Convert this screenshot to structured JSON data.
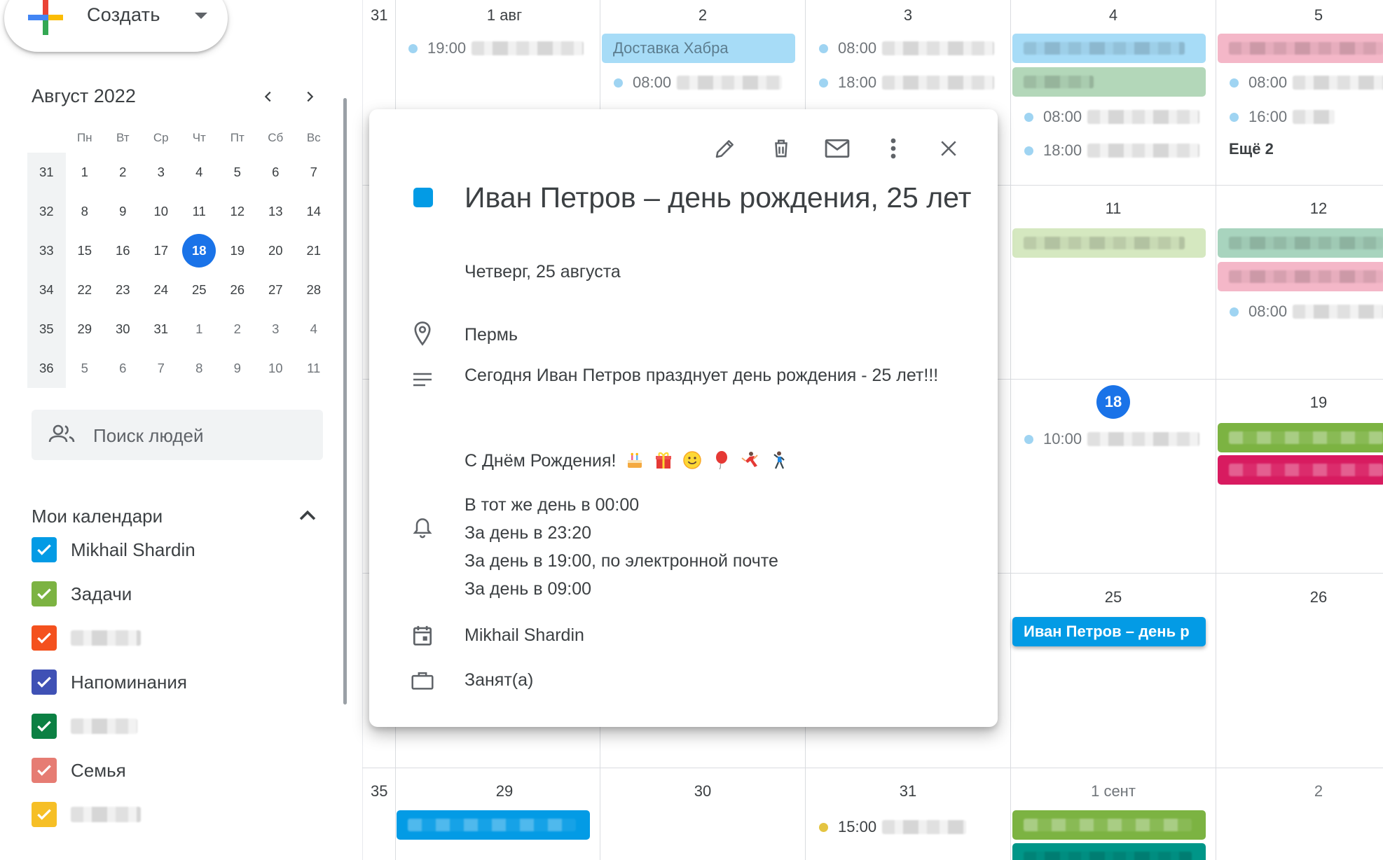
{
  "create": {
    "label": "Создать"
  },
  "mini": {
    "title": "Август 2022",
    "weekdays": [
      "Пн",
      "Вт",
      "Ср",
      "Чт",
      "Пт",
      "Сб",
      "Вс"
    ],
    "rows": [
      {
        "wk": "31",
        "days": [
          "1",
          "2",
          "3",
          "4",
          "5",
          "6",
          "7"
        ]
      },
      {
        "wk": "32",
        "days": [
          "8",
          "9",
          "10",
          "11",
          "12",
          "13",
          "14"
        ]
      },
      {
        "wk": "33",
        "days": [
          "15",
          "16",
          "17",
          "18",
          "19",
          "20",
          "21"
        ]
      },
      {
        "wk": "34",
        "days": [
          "22",
          "23",
          "24",
          "25",
          "26",
          "27",
          "28"
        ]
      },
      {
        "wk": "35",
        "days": [
          "29",
          "30",
          "31",
          "1",
          "2",
          "3",
          "4"
        ]
      },
      {
        "wk": "36",
        "days": [
          "5",
          "6",
          "7",
          "8",
          "9",
          "10",
          "11"
        ]
      }
    ],
    "today": "18"
  },
  "people_search": {
    "placeholder": "Поиск людей"
  },
  "my_calendars": {
    "title": "Мои календари",
    "items": [
      {
        "name": "Mikhail Shardin",
        "color": "#039be5"
      },
      {
        "name": "Задачи",
        "color": "#7cb342"
      },
      {
        "name": "",
        "color": "#f4511e"
      },
      {
        "name": "Напоминания",
        "color": "#3f51b5"
      },
      {
        "name": "",
        "color": "#0b8043"
      },
      {
        "name": "Семья",
        "color": "#e67c73"
      },
      {
        "name": "",
        "color": "#f6bf26"
      }
    ]
  },
  "grid": {
    "week_rows": [
      {
        "wk": "31",
        "days": [
          "1 авг",
          "2",
          "3",
          "4",
          "5"
        ]
      },
      {
        "wk": "",
        "days": [
          "",
          "",
          "",
          "11",
          "12"
        ]
      },
      {
        "wk": "",
        "days": [
          "",
          "",
          "",
          "18",
          "19"
        ]
      },
      {
        "wk": "",
        "days": [
          "",
          "",
          "",
          "25",
          "26"
        ]
      },
      {
        "wk": "35",
        "days": [
          "29",
          "30",
          "31",
          "1 сент",
          "2"
        ]
      }
    ],
    "events": {
      "aug1_time": "19:00",
      "aug2_bar": "Доставка Хабра",
      "aug2_time": "08:00",
      "aug3_time1": "08:00",
      "aug3_time2": "18:00",
      "aug4_time1": "08:00",
      "aug4_time2": "18:00",
      "aug5_time1": "08:00",
      "aug5_time2": "16:00",
      "aug5_more": "Ещё 2",
      "aug12_time": "08:00",
      "aug18_time": "10:00",
      "aug25_bar": "Иван Петров – день р",
      "aug31_time": "15:00"
    }
  },
  "popup": {
    "title": "Иван Петров – день рождения, 25 лет",
    "date": "Четверг, 25 августа",
    "location": "Пермь",
    "description_line1": "Сегодня Иван Петров празднует день рождения - 25 лет!!!",
    "description_line2": "С Днём Рождения!",
    "reminders": [
      "В тот же день в 00:00",
      "За день в 23:20",
      "За день в 19:00, по электронной почте",
      "За день в 09:00"
    ],
    "calendar": "Mikhail Shardin",
    "status": "Занят(а)",
    "event_color": "#039be5"
  }
}
